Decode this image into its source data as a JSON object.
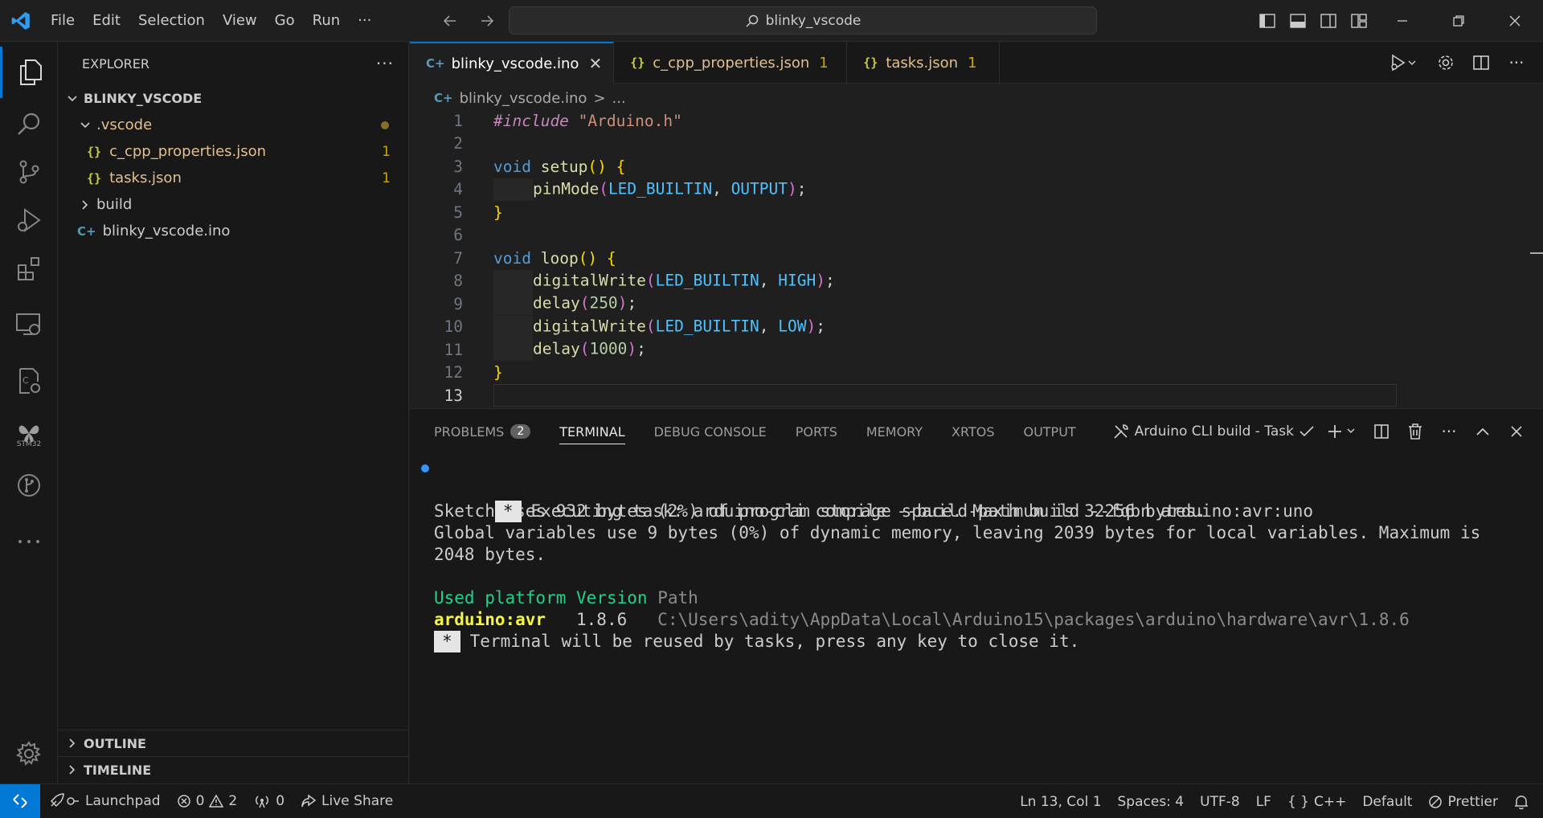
{
  "menu": [
    "File",
    "Edit",
    "Selection",
    "View",
    "Go",
    "Run",
    "···"
  ],
  "search": {
    "text": "blinky_vscode"
  },
  "activity": {
    "stm32_label": "STM32"
  },
  "explorer": {
    "title": "EXPLORER",
    "root": "BLINKY_VSCODE",
    "items": [
      {
        "label": ".vscode"
      },
      {
        "label": "c_cpp_properties.json",
        "badge": "1"
      },
      {
        "label": "tasks.json",
        "badge": "1"
      },
      {
        "label": "build"
      },
      {
        "label": "blinky_vscode.ino"
      }
    ],
    "outline": "OUTLINE",
    "timeline": "TIMELINE"
  },
  "tabs": [
    {
      "label": "blinky_vscode.ino"
    },
    {
      "label": "c_cpp_properties.json",
      "badge": "1"
    },
    {
      "label": "tasks.json",
      "badge": "1"
    }
  ],
  "breadcrumb": {
    "file": "blinky_vscode.ino",
    "sep": ">",
    "rest": "..."
  },
  "code": {
    "line_numbers": [
      "1",
      "2",
      "3",
      "4",
      "5",
      "6",
      "7",
      "8",
      "9",
      "10",
      "11",
      "12",
      "13"
    ],
    "l1_inc": "#include",
    "l1_str": "\"Arduino.h\"",
    "l3_kw": "void",
    "l3_fn": "setup",
    "l3_paren": "()",
    "l3_brace": "{",
    "l4_fn": "pinMode",
    "l4_a": "LED_BUILTIN",
    "l4_b": "OUTPUT",
    "l5_brace": "}",
    "l7_kw": "void",
    "l7_fn": "loop",
    "l7_paren": "()",
    "l7_brace": "{",
    "l8_fn": "digitalWrite",
    "l8_a": "LED_BUILTIN",
    "l8_b": "HIGH",
    "l9_fn": "delay",
    "l9_n": "250",
    "l10_fn": "digitalWrite",
    "l10_a": "LED_BUILTIN",
    "l10_b": "LOW",
    "l11_fn": "delay",
    "l11_n": "1000",
    "l12_brace": "}"
  },
  "panel": {
    "tabs": [
      "PROBLEMS",
      "TERMINAL",
      "DEBUG CONSOLE",
      "PORTS",
      "MEMORY",
      "XRTOS",
      "OUTPUT"
    ],
    "problems_count": "2",
    "task": "Arduino CLI build - Task"
  },
  "terminal": {
    "star": "*",
    "executing": "Executing task: arduino-cli compile --build-path build --fqbn arduino:avr:uno",
    "sketch": "Sketch uses 932 bytes (2%) of program storage space. Maximum is 32256 bytes.",
    "globals1": "Global variables use 9 bytes (0%) of dynamic memory, leaving 2039 bytes for local variables. Maximum is",
    "globals2": "2048 bytes.",
    "hdr_used": "Used platform",
    "hdr_version": "Version",
    "hdr_path": "Path",
    "platform": "arduino:avr",
    "version": "1.8.6",
    "path": "C:\\Users\\adity\\AppData\\Local\\Arduino15\\packages\\arduino\\hardware\\avr\\1.8.6",
    "reuse": "Terminal will be reused by tasks, press any key to close it."
  },
  "status": {
    "launchpad": "Launchpad",
    "errors": "0",
    "warnings": "2",
    "ports": "0",
    "liveshare": "Live Share",
    "position": "Ln 13, Col 1",
    "spaces": "Spaces: 4",
    "encoding": "UTF-8",
    "eol": "LF",
    "language": "C++",
    "lang_icon": "{ }",
    "config": "Default",
    "prettier": "Prettier"
  },
  "colors": {
    "accent": "#0078d4",
    "json_icon": "#cbcb41",
    "warning": "#cca700"
  }
}
